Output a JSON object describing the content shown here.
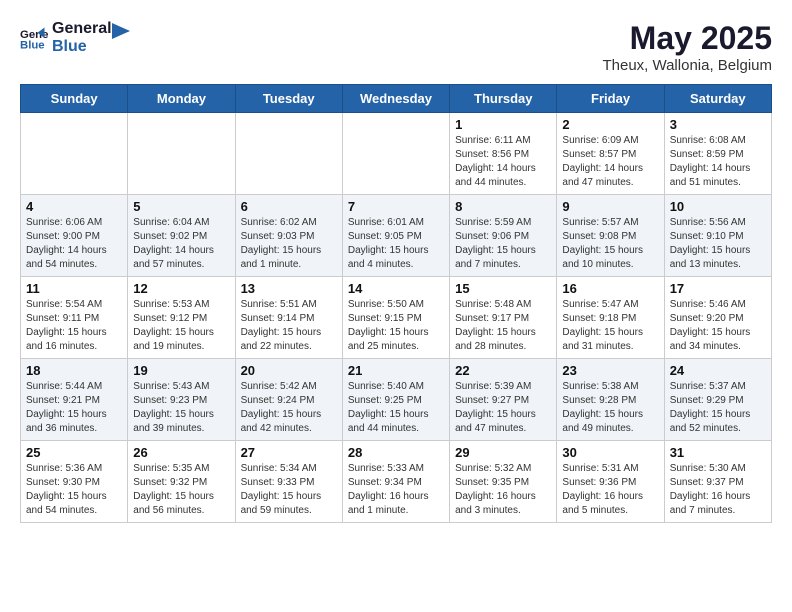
{
  "header": {
    "logo_line1": "General",
    "logo_line2": "Blue",
    "month": "May 2025",
    "location": "Theux, Wallonia, Belgium"
  },
  "weekdays": [
    "Sunday",
    "Monday",
    "Tuesday",
    "Wednesday",
    "Thursday",
    "Friday",
    "Saturday"
  ],
  "weeks": [
    [
      {
        "day": "",
        "info": ""
      },
      {
        "day": "",
        "info": ""
      },
      {
        "day": "",
        "info": ""
      },
      {
        "day": "",
        "info": ""
      },
      {
        "day": "1",
        "info": "Sunrise: 6:11 AM\nSunset: 8:56 PM\nDaylight: 14 hours\nand 44 minutes."
      },
      {
        "day": "2",
        "info": "Sunrise: 6:09 AM\nSunset: 8:57 PM\nDaylight: 14 hours\nand 47 minutes."
      },
      {
        "day": "3",
        "info": "Sunrise: 6:08 AM\nSunset: 8:59 PM\nDaylight: 14 hours\nand 51 minutes."
      }
    ],
    [
      {
        "day": "4",
        "info": "Sunrise: 6:06 AM\nSunset: 9:00 PM\nDaylight: 14 hours\nand 54 minutes."
      },
      {
        "day": "5",
        "info": "Sunrise: 6:04 AM\nSunset: 9:02 PM\nDaylight: 14 hours\nand 57 minutes."
      },
      {
        "day": "6",
        "info": "Sunrise: 6:02 AM\nSunset: 9:03 PM\nDaylight: 15 hours\nand 1 minute."
      },
      {
        "day": "7",
        "info": "Sunrise: 6:01 AM\nSunset: 9:05 PM\nDaylight: 15 hours\nand 4 minutes."
      },
      {
        "day": "8",
        "info": "Sunrise: 5:59 AM\nSunset: 9:06 PM\nDaylight: 15 hours\nand 7 minutes."
      },
      {
        "day": "9",
        "info": "Sunrise: 5:57 AM\nSunset: 9:08 PM\nDaylight: 15 hours\nand 10 minutes."
      },
      {
        "day": "10",
        "info": "Sunrise: 5:56 AM\nSunset: 9:10 PM\nDaylight: 15 hours\nand 13 minutes."
      }
    ],
    [
      {
        "day": "11",
        "info": "Sunrise: 5:54 AM\nSunset: 9:11 PM\nDaylight: 15 hours\nand 16 minutes."
      },
      {
        "day": "12",
        "info": "Sunrise: 5:53 AM\nSunset: 9:12 PM\nDaylight: 15 hours\nand 19 minutes."
      },
      {
        "day": "13",
        "info": "Sunrise: 5:51 AM\nSunset: 9:14 PM\nDaylight: 15 hours\nand 22 minutes."
      },
      {
        "day": "14",
        "info": "Sunrise: 5:50 AM\nSunset: 9:15 PM\nDaylight: 15 hours\nand 25 minutes."
      },
      {
        "day": "15",
        "info": "Sunrise: 5:48 AM\nSunset: 9:17 PM\nDaylight: 15 hours\nand 28 minutes."
      },
      {
        "day": "16",
        "info": "Sunrise: 5:47 AM\nSunset: 9:18 PM\nDaylight: 15 hours\nand 31 minutes."
      },
      {
        "day": "17",
        "info": "Sunrise: 5:46 AM\nSunset: 9:20 PM\nDaylight: 15 hours\nand 34 minutes."
      }
    ],
    [
      {
        "day": "18",
        "info": "Sunrise: 5:44 AM\nSunset: 9:21 PM\nDaylight: 15 hours\nand 36 minutes."
      },
      {
        "day": "19",
        "info": "Sunrise: 5:43 AM\nSunset: 9:23 PM\nDaylight: 15 hours\nand 39 minutes."
      },
      {
        "day": "20",
        "info": "Sunrise: 5:42 AM\nSunset: 9:24 PM\nDaylight: 15 hours\nand 42 minutes."
      },
      {
        "day": "21",
        "info": "Sunrise: 5:40 AM\nSunset: 9:25 PM\nDaylight: 15 hours\nand 44 minutes."
      },
      {
        "day": "22",
        "info": "Sunrise: 5:39 AM\nSunset: 9:27 PM\nDaylight: 15 hours\nand 47 minutes."
      },
      {
        "day": "23",
        "info": "Sunrise: 5:38 AM\nSunset: 9:28 PM\nDaylight: 15 hours\nand 49 minutes."
      },
      {
        "day": "24",
        "info": "Sunrise: 5:37 AM\nSunset: 9:29 PM\nDaylight: 15 hours\nand 52 minutes."
      }
    ],
    [
      {
        "day": "25",
        "info": "Sunrise: 5:36 AM\nSunset: 9:30 PM\nDaylight: 15 hours\nand 54 minutes."
      },
      {
        "day": "26",
        "info": "Sunrise: 5:35 AM\nSunset: 9:32 PM\nDaylight: 15 hours\nand 56 minutes."
      },
      {
        "day": "27",
        "info": "Sunrise: 5:34 AM\nSunset: 9:33 PM\nDaylight: 15 hours\nand 59 minutes."
      },
      {
        "day": "28",
        "info": "Sunrise: 5:33 AM\nSunset: 9:34 PM\nDaylight: 16 hours\nand 1 minute."
      },
      {
        "day": "29",
        "info": "Sunrise: 5:32 AM\nSunset: 9:35 PM\nDaylight: 16 hours\nand 3 minutes."
      },
      {
        "day": "30",
        "info": "Sunrise: 5:31 AM\nSunset: 9:36 PM\nDaylight: 16 hours\nand 5 minutes."
      },
      {
        "day": "31",
        "info": "Sunrise: 5:30 AM\nSunset: 9:37 PM\nDaylight: 16 hours\nand 7 minutes."
      }
    ]
  ]
}
